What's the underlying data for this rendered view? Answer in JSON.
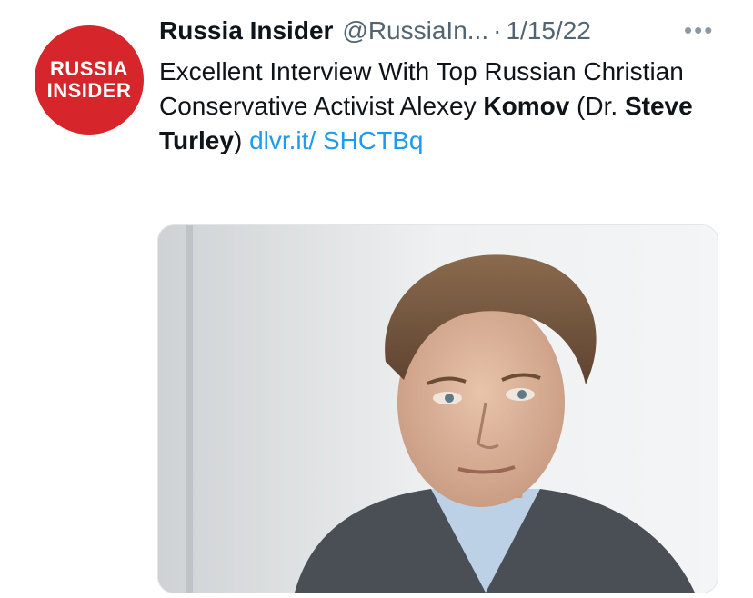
{
  "avatar": {
    "line1": "RUSSIA",
    "line2": "INSIDER",
    "color": "#d7262b"
  },
  "header": {
    "display_name": "Russia Insider",
    "handle": "@RussiaIn...",
    "separator": "·",
    "date": "1/15/22",
    "more_icon": "more-horizontal-icon"
  },
  "tweet": {
    "text_part1": "Excellent Interview With Top Russian Christian Conservative Activist Alexey ",
    "bold1": "Komov",
    "text_part2": " (Dr. ",
    "bold2": "Steve Turley",
    "text_part3": ") ",
    "link": "dlvr.it/ SHCTBq"
  },
  "colors": {
    "link": "#1d9bf0",
    "secondary": "#536471",
    "text": "#0f1419"
  }
}
